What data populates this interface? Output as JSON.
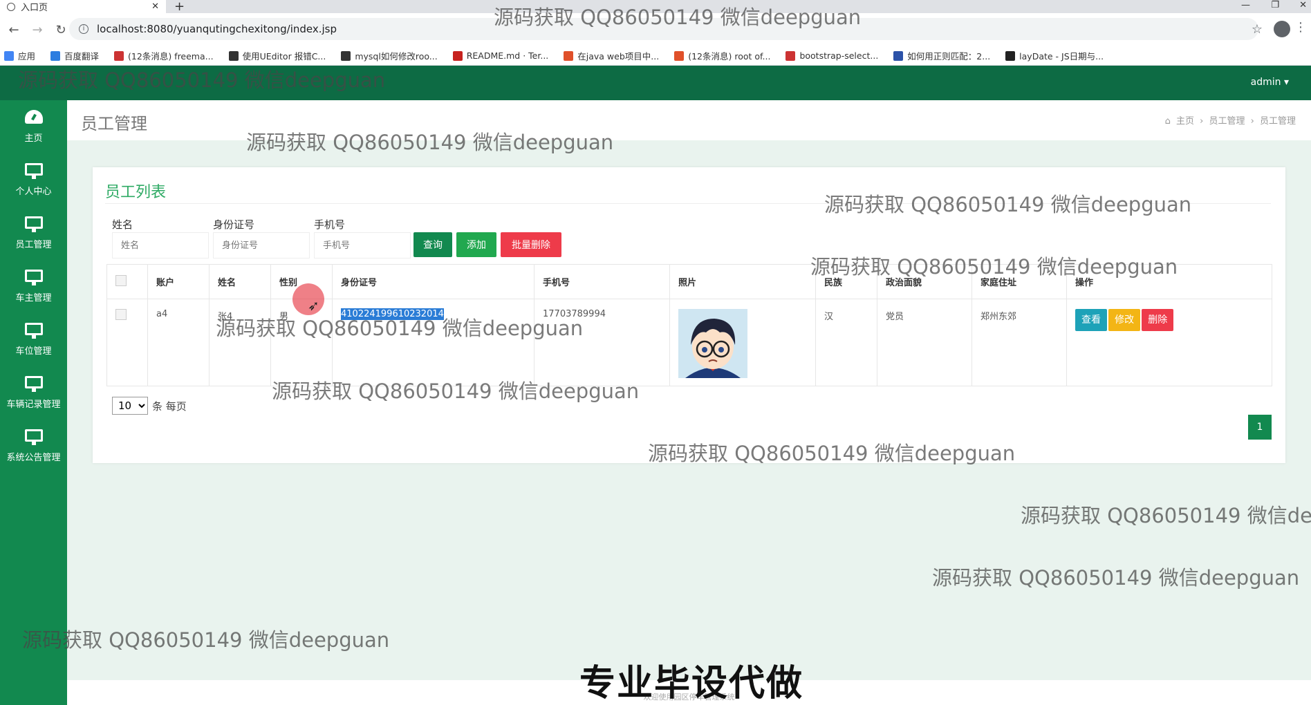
{
  "browser": {
    "tab_title": "入口页",
    "new_tab": "+",
    "url": "localhost:8080/yuanqutingchexitong/index.jsp",
    "bookmarks": [
      {
        "label": "应用",
        "color": "#4285f4"
      },
      {
        "label": "百度翻译",
        "color": "#2d7de0"
      },
      {
        "label": "(12条消息) freema...",
        "color": "#c33"
      },
      {
        "label": "使用UEditor 报错C...",
        "color": "#333"
      },
      {
        "label": "mysql如何修改roo...",
        "color": "#333"
      },
      {
        "label": "README.md · Ter...",
        "color": "#c7221f"
      },
      {
        "label": "在java web项目中...",
        "color": "#e0502a"
      },
      {
        "label": "(12条消息) root of...",
        "color": "#e0502a"
      },
      {
        "label": "bootstrap-select...",
        "color": "#c33"
      },
      {
        "label": "如何用正则匹配：2...",
        "color": "#2c52a8"
      },
      {
        "label": "layDate - JS日期与...",
        "color": "#222"
      }
    ]
  },
  "header": {
    "user": "admin ▾"
  },
  "sidebar": {
    "items": [
      {
        "label": "主页",
        "icon": "dashboard-icon"
      },
      {
        "label": "个人中心",
        "icon": "monitor-icon"
      },
      {
        "label": "员工管理",
        "icon": "monitor-icon"
      },
      {
        "label": "车主管理",
        "icon": "monitor-icon"
      },
      {
        "label": "车位管理",
        "icon": "monitor-icon"
      },
      {
        "label": "车辆记录管理",
        "icon": "monitor-icon"
      },
      {
        "label": "系统公告管理",
        "icon": "monitor-icon"
      }
    ]
  },
  "page": {
    "title": "员工管理",
    "breadcrumb": [
      "主页",
      "员工管理",
      "员工管理"
    ]
  },
  "card": {
    "title": "员工列表",
    "filters": [
      {
        "label": "姓名",
        "placeholder": "姓名"
      },
      {
        "label": "身份证号",
        "placeholder": "身份证号"
      },
      {
        "label": "手机号",
        "placeholder": "手机号"
      }
    ],
    "buttons": {
      "search": "查询",
      "add": "添加",
      "batch_delete": "批量删除"
    },
    "columns": [
      "账户",
      "姓名",
      "性别",
      "身份证号",
      "手机号",
      "照片",
      "民族",
      "政治面貌",
      "家庭住址",
      "操作"
    ],
    "rows": [
      {
        "account": "a4",
        "name": "张4",
        "gender": "男",
        "id_number": "410224199610232014",
        "phone": "17703789994",
        "ethnicity": "汉",
        "political": "党员",
        "address": "郑州东郊"
      }
    ],
    "row_actions": {
      "view": "查看",
      "edit": "修改",
      "delete": "删除"
    },
    "pager": {
      "per_page": "10",
      "per_page_suffix": "条 每页",
      "current_page": "1"
    }
  },
  "footer": {
    "text": "欢迎使用园区停车管理系统",
    "banner": "专业毕设代做"
  },
  "watermark": "源码获取 QQ86050149 微信deepguan",
  "colors": {
    "header": "#0d6b44",
    "sidebar": "#12894f",
    "accent": "#2eaa64",
    "search_button": "#12894f",
    "add_button": "#21a84f",
    "delete_button": "#ee3b4a",
    "view_button": "#1da2b8",
    "edit_button": "#f3b515"
  }
}
